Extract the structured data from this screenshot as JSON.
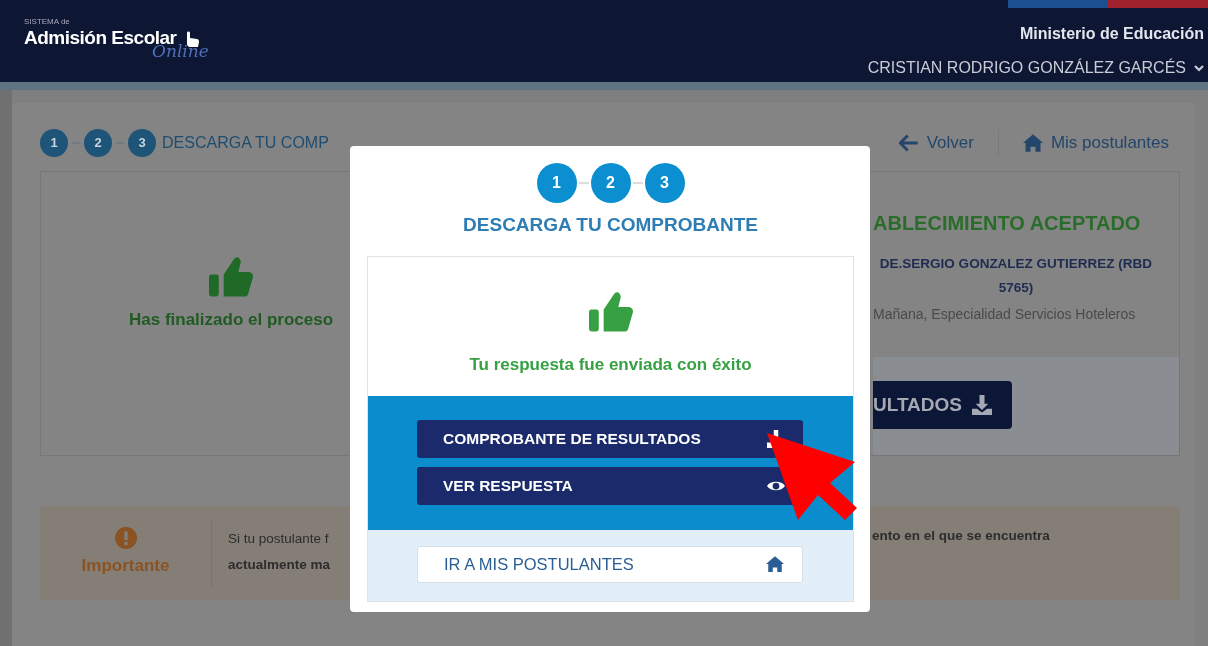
{
  "header": {
    "logo": {
      "small": "SISTEMA de",
      "main": "Admisión Escolar",
      "script": "Online"
    },
    "ministry": "Ministerio de Educación",
    "user": "CRISTIAN RODRIGO GONZÁLEZ GARCÉS"
  },
  "progress": {
    "steps": [
      "1",
      "2",
      "3"
    ],
    "title": "DESCARGA TU COMP"
  },
  "nav": [
    {
      "label": "Volver",
      "kind": "back"
    },
    {
      "label": "Mis postulantes",
      "kind": "home"
    }
  ],
  "summary": {
    "message": "Has finalizado el proceso",
    "title": "ABLECIMIENTO ACEPTADO",
    "school": "DE.SERGIO GONZALEZ GUTIERREZ (RBD 5765)",
    "detail": "Mañana, Especialidad Servicios Hoteleros",
    "button": "ULTADOS"
  },
  "notice": {
    "label": "Importante",
    "lines": [
      "Si tu postulante f",
      "actualmente ma"
    ],
    "right_text": "ento en el que se encuentra"
  },
  "modal": {
    "steps": [
      "1",
      "2",
      "3"
    ],
    "title": "DESCARGA TU COMPROBANTE",
    "message": "Tu respuesta fue enviada con éxito",
    "actions": [
      {
        "label": "COMPROBANTE DE RESULTADOS",
        "kind": "download"
      },
      {
        "label": "VER RESPUESTA",
        "kind": "view"
      },
      {
        "label": "IR A MIS POSTULANTES",
        "kind": "home"
      }
    ]
  }
}
